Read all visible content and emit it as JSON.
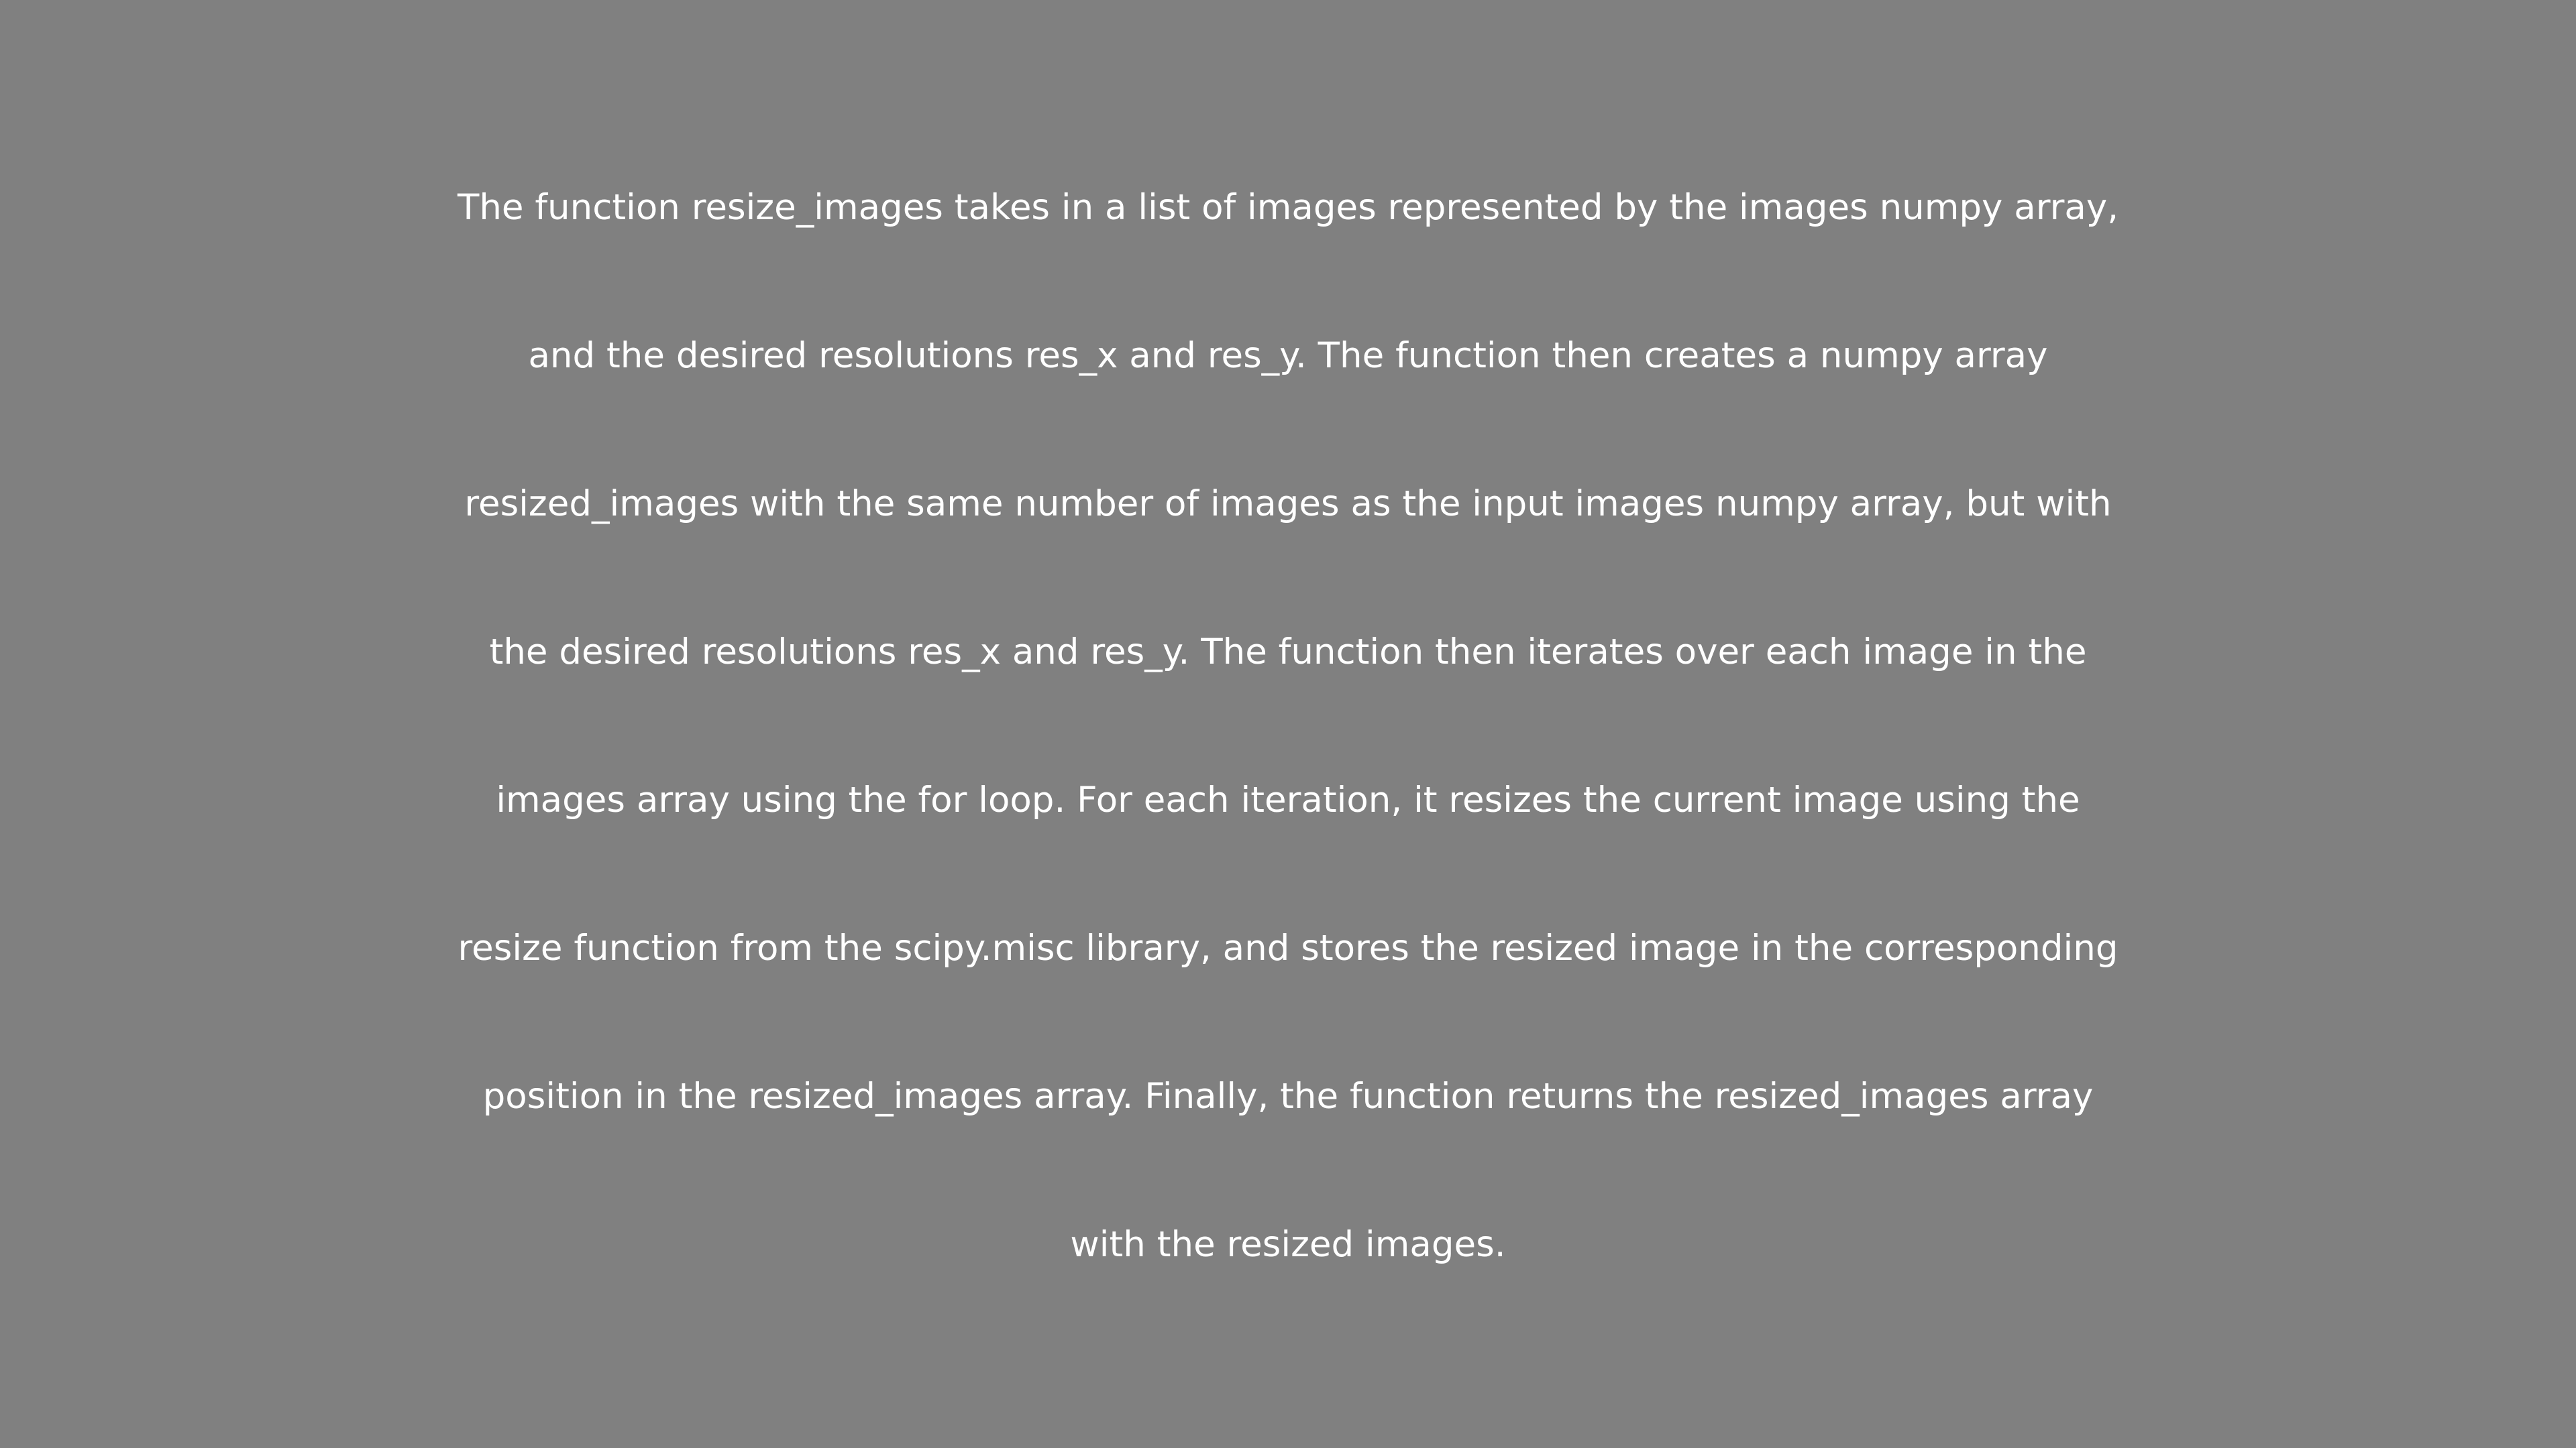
{
  "paragraph": {
    "lines": [
      "The function resize_images takes in a list of images represented by the images numpy array,",
      "and the desired resolutions res_x and res_y. The function then creates a numpy array",
      "resized_images with the same number of images as the input images numpy array, but with",
      "the desired resolutions res_x and res_y. The function then iterates over each image in the",
      "images array using the for loop. For each iteration, it resizes the current image using the",
      "resize function from the scipy.misc library, and stores the resized image in the corresponding",
      "position in the resized_images array. Finally, the function returns the resized_images array",
      "with the resized images."
    ]
  },
  "colors": {
    "background": "#808080",
    "text": "#ffffff"
  }
}
